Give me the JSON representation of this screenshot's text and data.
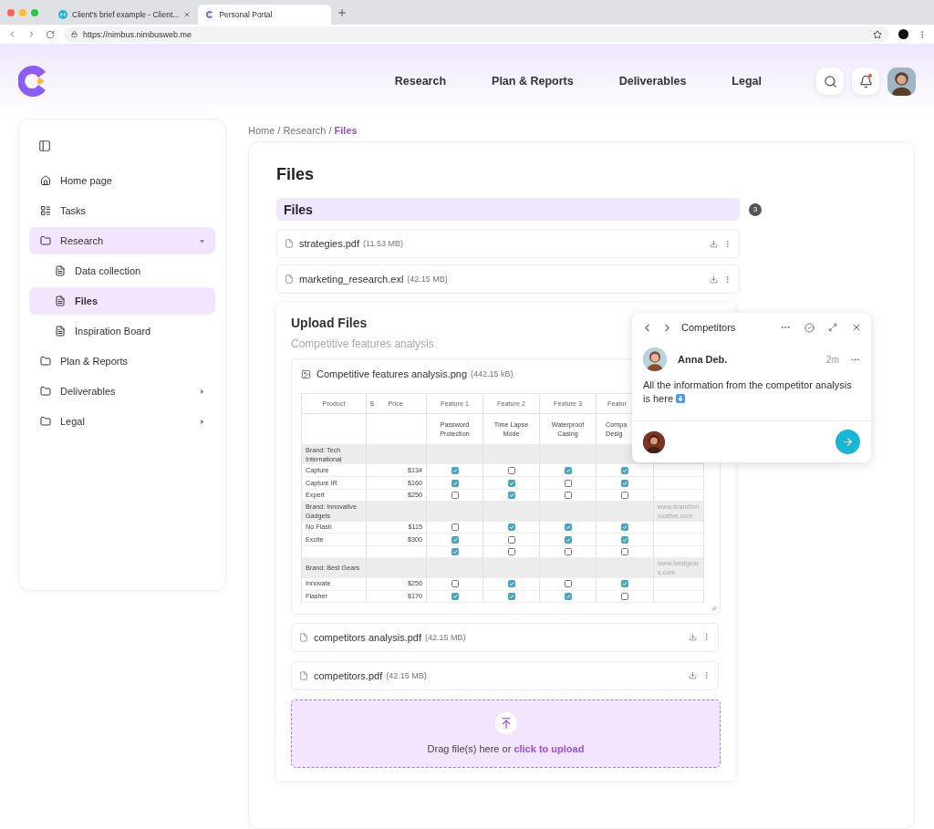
{
  "browser": {
    "tabs": [
      {
        "title": "Client's brief example - Client...",
        "selected": false,
        "kind": "notes"
      },
      {
        "title": "Personal Portal",
        "selected": true,
        "kind": "portal"
      }
    ],
    "url": "https://nimbus.nimbusweb.me"
  },
  "header": {
    "nav": [
      {
        "label": "Research"
      },
      {
        "label": "Plan & Reports"
      },
      {
        "label": "Deliverables"
      },
      {
        "label": "Legal"
      }
    ],
    "unread": true
  },
  "sidebar": {
    "items": [
      {
        "label": "Home page",
        "kind": "home",
        "selected": false,
        "expandable": false
      },
      {
        "label": "Tasks",
        "kind": "tasks",
        "selected": false,
        "expandable": false
      },
      {
        "label": "Research",
        "kind": "folder",
        "selected": true,
        "expandable": true,
        "expanded": true,
        "children": [
          {
            "label": "Data collection",
            "kind": "page",
            "selected": false
          },
          {
            "label": "Files",
            "kind": "page",
            "selected": true
          },
          {
            "label": "Inspiration Board",
            "kind": "page",
            "selected": false
          }
        ]
      },
      {
        "label": "Plan & Reports",
        "kind": "folder",
        "selected": false,
        "expandable": false
      },
      {
        "label": "Deliverables",
        "kind": "folder",
        "selected": false,
        "expandable": true,
        "expanded": false
      },
      {
        "label": "Legal",
        "kind": "folder",
        "selected": false,
        "expandable": true,
        "expanded": false
      }
    ]
  },
  "breadcrumb": [
    {
      "kind": "link",
      "label": "Home",
      "current": false
    },
    {
      "kind": "separator",
      "label": "/"
    },
    {
      "kind": "link",
      "label": "Research",
      "current": false
    },
    {
      "kind": "separator",
      "label": "/"
    },
    {
      "kind": "link",
      "label": "Files",
      "current": true
    }
  ],
  "page_title": "Files",
  "files_group": {
    "title": "Files",
    "count": "3",
    "files": [
      {
        "name": "strategies.pdf",
        "size": "(11.53 MB)"
      },
      {
        "name": "marketing_research.exl",
        "size": "(42.15 MB)"
      }
    ]
  },
  "upload": {
    "title": "Upload Files",
    "subtitle": "Competitive features analysis",
    "attachment": {
      "name": "Competitive features analysis.png",
      "size": "(442.15 kB)",
      "table": {
        "columns": [
          "Product",
          "$",
          "Price",
          "Feature 1",
          "Feature 2",
          "Feature 3",
          "Featur"
        ],
        "features": [
          "Password Protection",
          "Time Lapse Mode",
          "Waterproof Casing",
          "Compa Desig"
        ],
        "rows": [
          {
            "kind": "brand",
            "name": "Brand: Tech International"
          },
          {
            "kind": "product",
            "name": "Capture",
            "price": "$134",
            "checks": [
              true,
              false,
              true,
              true
            ]
          },
          {
            "kind": "product",
            "name": "Capture IR",
            "price": "$160",
            "checks": [
              true,
              true,
              false,
              true
            ]
          },
          {
            "kind": "product",
            "name": "Expert",
            "price": "$250",
            "checks": [
              false,
              true,
              false,
              false
            ]
          },
          {
            "kind": "brand",
            "name": "Brand: Innovative Gadgets",
            "link": "www.brandinnovative.com"
          },
          {
            "kind": "product",
            "name": "No Flash",
            "price": "$115",
            "checks": [
              false,
              true,
              true,
              true
            ]
          },
          {
            "kind": "product",
            "name": "Excite",
            "price": "$300",
            "checks": [
              true,
              false,
              true,
              true
            ]
          },
          {
            "kind": "product",
            "checks": [
              true,
              false,
              false,
              false
            ]
          },
          {
            "kind": "brand",
            "name": "Brand: Best Gears",
            "link": "www.bestgears.com"
          },
          {
            "kind": "product",
            "name": "Innovate",
            "price": "$250",
            "checks": [
              false,
              true,
              false,
              true
            ]
          },
          {
            "kind": "product",
            "name": "Flasher",
            "price": "$170",
            "checks": [
              true,
              true,
              true,
              false
            ]
          }
        ]
      }
    },
    "files": [
      {
        "name": "competitors analysis.pdf",
        "size": "(42.15 MB)"
      },
      {
        "name": "competitors.pdf",
        "size": "(42.15 MB)"
      }
    ],
    "dropzone": {
      "text": "Drag file(s) here or",
      "link": "click to upload"
    }
  },
  "comment": {
    "title": "Competitors",
    "author": "Anna Deb.",
    "time": "2m",
    "message": "All the information from the competitor analysis is here"
  }
}
